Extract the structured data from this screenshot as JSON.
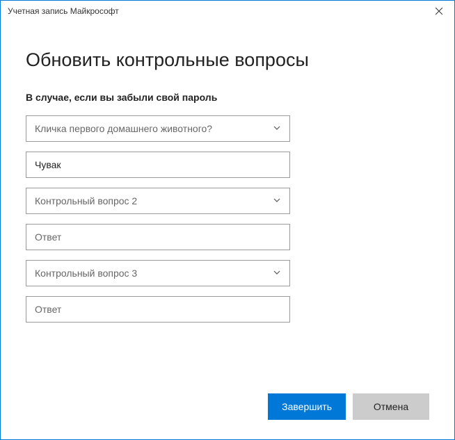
{
  "window": {
    "title": "Учетная запись Майкрософт"
  },
  "page": {
    "heading": "Обновить контрольные вопросы",
    "subheading": "В случае, если вы забыли свой пароль"
  },
  "questions": [
    {
      "select_label": "Кличка первого домашнего животного?",
      "answer_value": "Чувак",
      "answer_placeholder": "Ответ"
    },
    {
      "select_label": "Контрольный вопрос 2",
      "answer_value": "",
      "answer_placeholder": "Ответ"
    },
    {
      "select_label": "Контрольный вопрос 3",
      "answer_value": "",
      "answer_placeholder": "Ответ"
    }
  ],
  "buttons": {
    "primary": "Завершить",
    "secondary": "Отмена"
  }
}
